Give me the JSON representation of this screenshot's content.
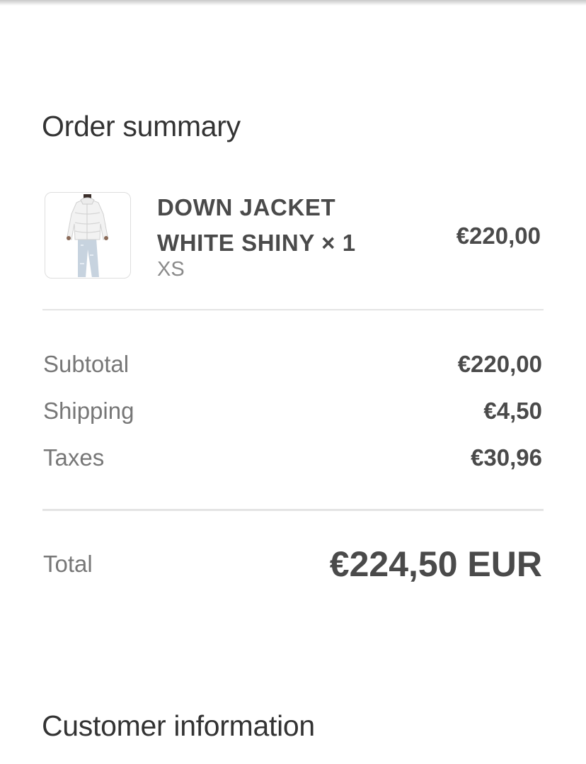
{
  "order_summary": {
    "title": "Order summary",
    "item": {
      "name": "DOWN JACKET WHITE SHINY × 1",
      "variant": "XS",
      "price": "€220,00",
      "image": "white-down-jacket-product-image"
    },
    "rows": [
      {
        "label": "Subtotal",
        "value": "€220,00"
      },
      {
        "label": "Shipping",
        "value": "€4,50"
      },
      {
        "label": "Taxes",
        "value": "€30,96"
      }
    ],
    "total": {
      "label": "Total",
      "value": "€224,50 EUR"
    }
  },
  "customer_information": {
    "title": "Customer information"
  }
}
